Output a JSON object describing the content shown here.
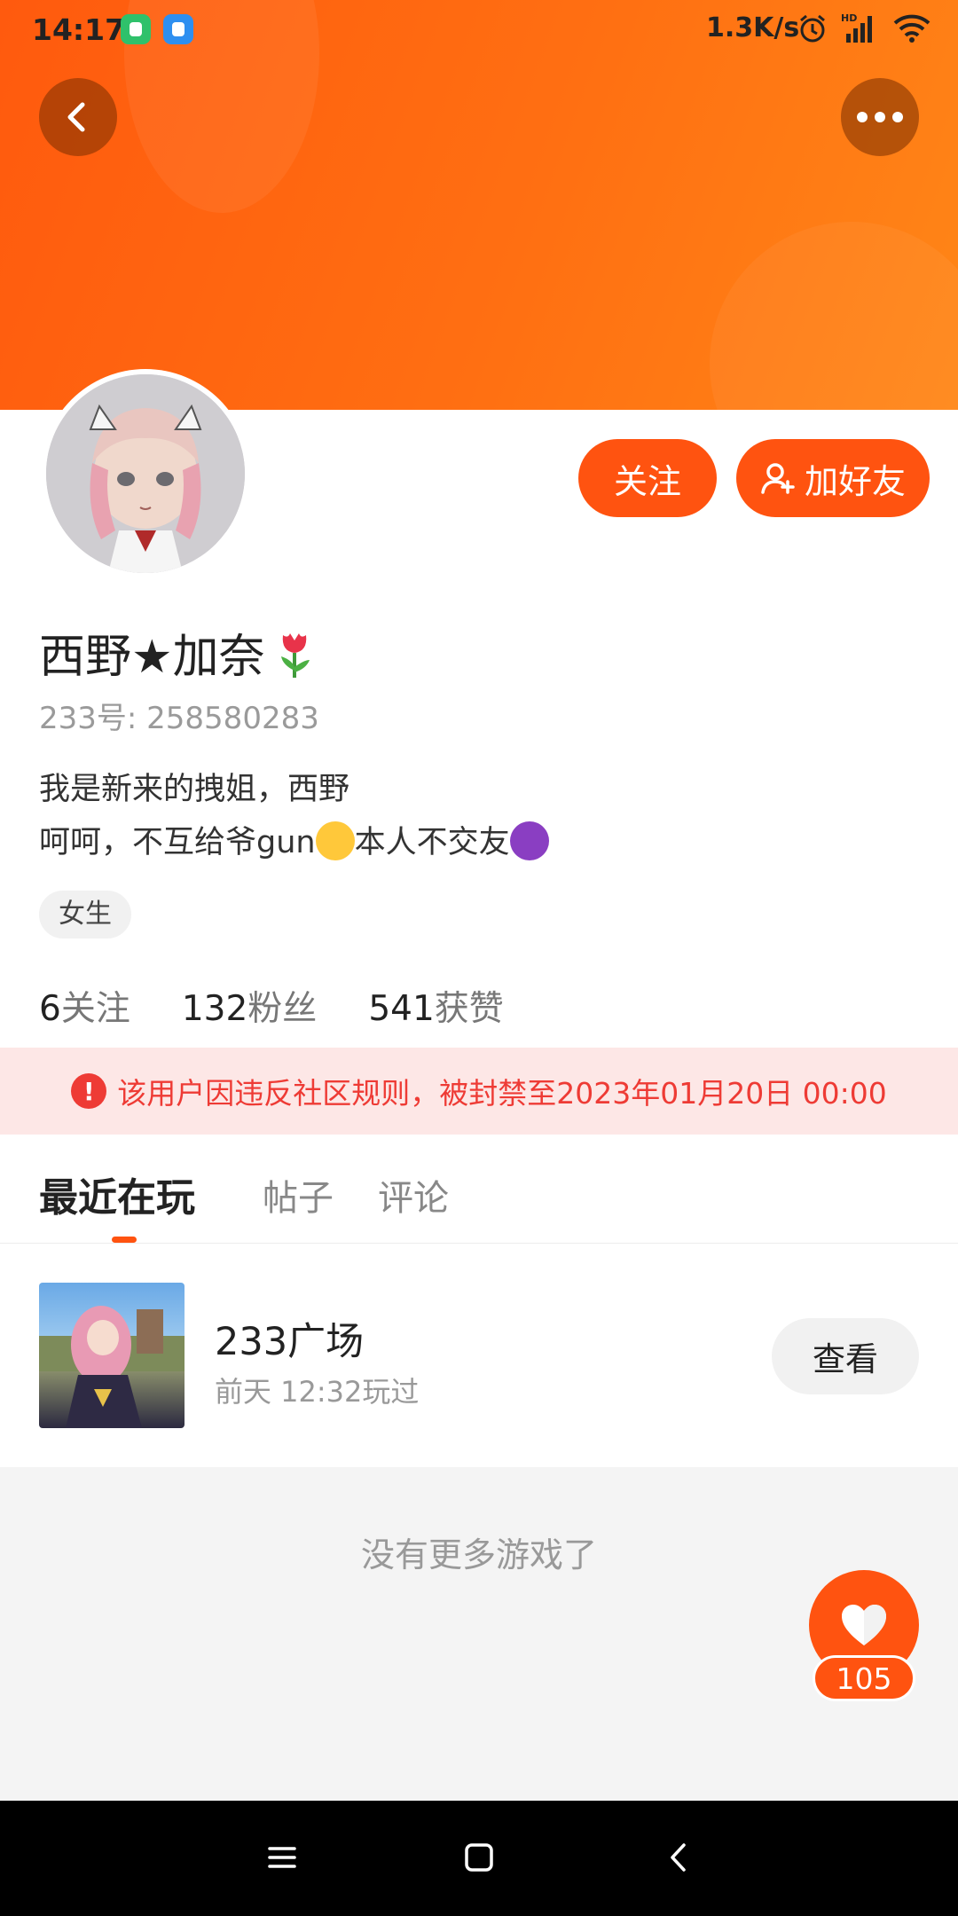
{
  "status_bar": {
    "time": "14:17",
    "speed": "1.3K/s"
  },
  "profile": {
    "name": "西野★加奈",
    "uid": "233号: 258580283",
    "bio_line1": "我是新来的拽姐，西野",
    "bio_line2_a": "呵呵，不互给爷gun",
    "bio_line2_b": "本人不交友",
    "gender": "女生",
    "stats": {
      "following_count": "6",
      "following_label": "关注",
      "fans_count": "132",
      "fans_label": "粉丝",
      "likes_count": "541",
      "likes_label": "获赞"
    }
  },
  "actions": {
    "follow": "关注",
    "add_friend": "加好友"
  },
  "ban_notice": "该用户因违反社区规则，被封禁至2023年01月20日 00:00",
  "tabs": [
    {
      "label": "最近在玩",
      "active": true
    },
    {
      "label": "帖子",
      "active": false
    },
    {
      "label": "评论",
      "active": false
    }
  ],
  "games": [
    {
      "title": "233广场",
      "subtitle": "前天 12:32玩过",
      "button": "查看"
    }
  ],
  "no_more": "没有更多游戏了",
  "like_fab": {
    "count": "105"
  },
  "colors": {
    "accent": "#ff5310",
    "ban_text": "#ee3b35",
    "ban_bg": "#fde7e6"
  },
  "icons": [
    "back-icon",
    "more-icon",
    "shield-app-icon",
    "chat-app-icon",
    "alarm-icon",
    "signal-icon",
    "wifi-icon",
    "add-user-icon",
    "warning-icon",
    "heart-icon",
    "menu-icon",
    "home-icon",
    "nav-back-icon"
  ]
}
